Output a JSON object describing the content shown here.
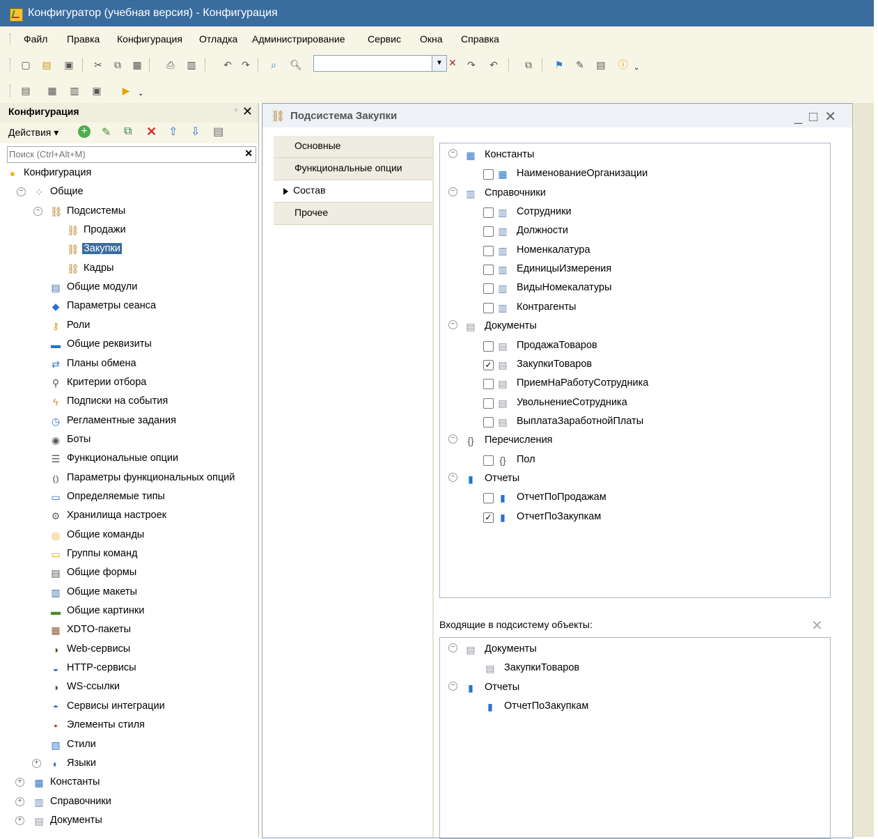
{
  "window": {
    "title": "Конфигуратор (учебная версия) - Конфигурация"
  },
  "menu": [
    "Файл",
    "Правка",
    "Конфигурация",
    "Отладка",
    "Администрирование",
    "Сервис",
    "Окна",
    "Справка"
  ],
  "toolbar": {
    "search_value": ""
  },
  "left_panel": {
    "title": "Конфигурация",
    "actions_label": "Действия",
    "search_placeholder": "Поиск (Ctrl+Alt+M)",
    "tree": [
      {
        "label": "Конфигурация",
        "icon": "config-icon"
      },
      {
        "label": "Общие",
        "icon": "common-icon"
      },
      {
        "label": "Подсистемы",
        "icon": "subsystem-icon"
      },
      {
        "label": "Продажи",
        "icon": "subsystem-icon"
      },
      {
        "label": "Закупки",
        "icon": "subsystem-icon"
      },
      {
        "label": "Кадры",
        "icon": "subsystem-icon"
      },
      {
        "label": "Общие модули",
        "icon": "module-icon"
      },
      {
        "label": "Параметры сеанса",
        "icon": "session-param-icon"
      },
      {
        "label": "Роли",
        "icon": "role-icon"
      },
      {
        "label": "Общие реквизиты",
        "icon": "attribute-icon"
      },
      {
        "label": "Планы обмена",
        "icon": "exchange-plan-icon"
      },
      {
        "label": "Критерии отбора",
        "icon": "filter-criteria-icon"
      },
      {
        "label": "Подписки на события",
        "icon": "event-subscription-icon"
      },
      {
        "label": "Регламентные задания",
        "icon": "scheduled-job-icon"
      },
      {
        "label": "Боты",
        "icon": "bot-icon"
      },
      {
        "label": "Функциональные опции",
        "icon": "functional-option-icon"
      },
      {
        "label": "Параметры функциональных опций",
        "icon": "functional-option-param-icon"
      },
      {
        "label": "Определяемые типы",
        "icon": "defined-type-icon"
      },
      {
        "label": "Хранилища настроек",
        "icon": "settings-storage-icon"
      },
      {
        "label": "Общие команды",
        "icon": "command-icon"
      },
      {
        "label": "Группы команд",
        "icon": "command-group-icon"
      },
      {
        "label": "Общие формы",
        "icon": "form-icon"
      },
      {
        "label": "Общие макеты",
        "icon": "template-icon"
      },
      {
        "label": "Общие картинки",
        "icon": "picture-icon"
      },
      {
        "label": "XDTO-пакеты",
        "icon": "xdto-icon"
      },
      {
        "label": "Web-сервисы",
        "icon": "web-service-icon"
      },
      {
        "label": "HTTP-сервисы",
        "icon": "http-service-icon"
      },
      {
        "label": "WS-ссылки",
        "icon": "ws-link-icon"
      },
      {
        "label": "Сервисы интеграции",
        "icon": "integration-service-icon"
      },
      {
        "label": "Элементы стиля",
        "icon": "style-item-icon"
      },
      {
        "label": "Стили",
        "icon": "style-icon"
      },
      {
        "label": "Языки",
        "icon": "language-icon"
      },
      {
        "label": "Константы",
        "icon": "constant-icon"
      },
      {
        "label": "Справочники",
        "icon": "catalog-icon"
      },
      {
        "label": "Документы",
        "icon": "document-icon"
      }
    ]
  },
  "editor": {
    "title": "Подсистема Закупки",
    "tabs": [
      "Основные",
      "Функциональные опции",
      "Состав",
      "Прочее"
    ],
    "active_tab": "Состав",
    "content": [
      {
        "label": "Константы",
        "icon": "constant-icon"
      },
      {
        "label": "НаименованиеОрганизации",
        "icon": "constant-icon",
        "checked": false
      },
      {
        "label": "Справочники",
        "icon": "catalog-icon"
      },
      {
        "label": "Сотрудники",
        "icon": "catalog-icon",
        "checked": false
      },
      {
        "label": "Должности",
        "icon": "catalog-icon",
        "checked": false
      },
      {
        "label": "Номенкалатура",
        "icon": "catalog-icon",
        "checked": false
      },
      {
        "label": "ЕдиницыИзмерения",
        "icon": "catalog-icon",
        "checked": false
      },
      {
        "label": "ВидыНомекалатуры",
        "icon": "catalog-icon",
        "checked": false
      },
      {
        "label": "Контрагенты",
        "icon": "catalog-icon",
        "checked": false
      },
      {
        "label": "Документы",
        "icon": "document-icon"
      },
      {
        "label": "ПродажаТоваров",
        "icon": "document-icon",
        "checked": false
      },
      {
        "label": "ЗакупкиТоваров",
        "icon": "document-icon",
        "checked": true
      },
      {
        "label": "ПриемНаРаботуСотрудника",
        "icon": "document-icon",
        "checked": false
      },
      {
        "label": "УвольнениеСотрудника",
        "icon": "document-icon",
        "checked": false
      },
      {
        "label": "ВыплатаЗаработнойПлаты",
        "icon": "document-icon",
        "checked": false
      },
      {
        "label": "Перечисления",
        "icon": "enum-icon"
      },
      {
        "label": "Пол",
        "icon": "enum-icon",
        "checked": false
      },
      {
        "label": "Отчеты",
        "icon": "report-icon"
      },
      {
        "label": "ОтчетПоПродажам",
        "icon": "report-icon",
        "checked": false
      },
      {
        "label": "ОтчетПоЗакупкам",
        "icon": "report-icon",
        "checked": true
      }
    ],
    "included_label": "Входящие в подсистему объекты:",
    "included": [
      {
        "label": "Документы",
        "icon": "document-icon"
      },
      {
        "label": "ЗакупкиТоваров",
        "icon": "document-icon"
      },
      {
        "label": "Отчеты",
        "icon": "report-icon"
      },
      {
        "label": "ОтчетПоЗакупкам",
        "icon": "report-icon"
      }
    ]
  }
}
